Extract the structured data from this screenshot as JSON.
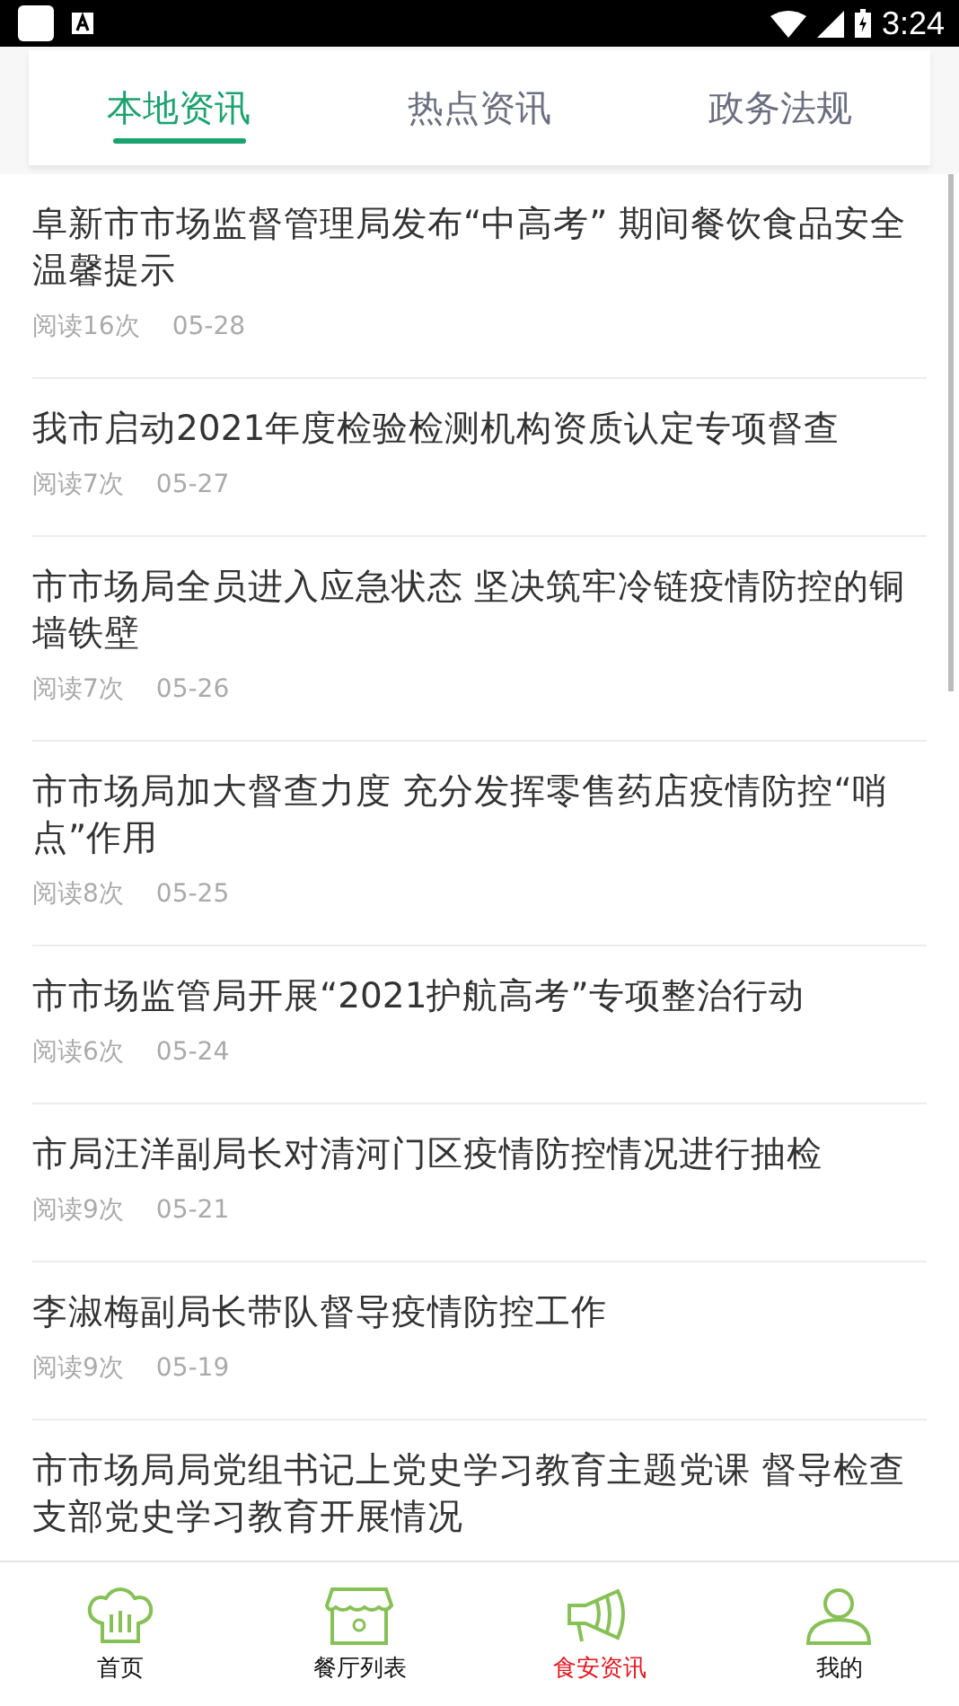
{
  "status_bar": {
    "time": "3:24"
  },
  "tabs": [
    {
      "label": "本地资讯",
      "selected": true
    },
    {
      "label": "热点资讯",
      "selected": false
    },
    {
      "label": "政务法规",
      "selected": false
    }
  ],
  "articles": [
    {
      "title": "阜新市市场监督管理局发布“中高考” 期间餐饮食品安全温馨提示",
      "reads": "阅读16次",
      "date": "05-28"
    },
    {
      "title": "我市启动2021年度检验检测机构资质认定专项督查",
      "reads": "阅读7次",
      "date": "05-27"
    },
    {
      "title": "市市场局全员进入应急状态 坚决筑牢冷链疫情防控的铜墙铁壁",
      "reads": "阅读7次",
      "date": "05-26"
    },
    {
      "title": "市市场局加大督查力度 充分发挥零售药店疫情防控“哨点”作用",
      "reads": "阅读8次",
      "date": "05-25"
    },
    {
      "title": "市市场监管局开展“2021护航高考”专项整治行动",
      "reads": "阅读6次",
      "date": "05-24"
    },
    {
      "title": "市局汪洋副局长对清河门区疫情防控情况进行抽检",
      "reads": "阅读9次",
      "date": "05-21"
    },
    {
      "title": "李淑梅副局长带队督导疫情防控工作",
      "reads": "阅读9次",
      "date": "05-19"
    },
    {
      "title": "市市场局局党组书记上党史学习教育主题党课 督导检查支部党史学习教育开展情况"
    }
  ],
  "bottom_nav": [
    {
      "kind": "home",
      "label": "首页",
      "selected": false
    },
    {
      "kind": "shop",
      "label": "餐厅列表",
      "selected": false
    },
    {
      "kind": "megaphone",
      "label": "食安资讯",
      "selected": true
    },
    {
      "kind": "profile",
      "label": "我的",
      "selected": false
    }
  ]
}
